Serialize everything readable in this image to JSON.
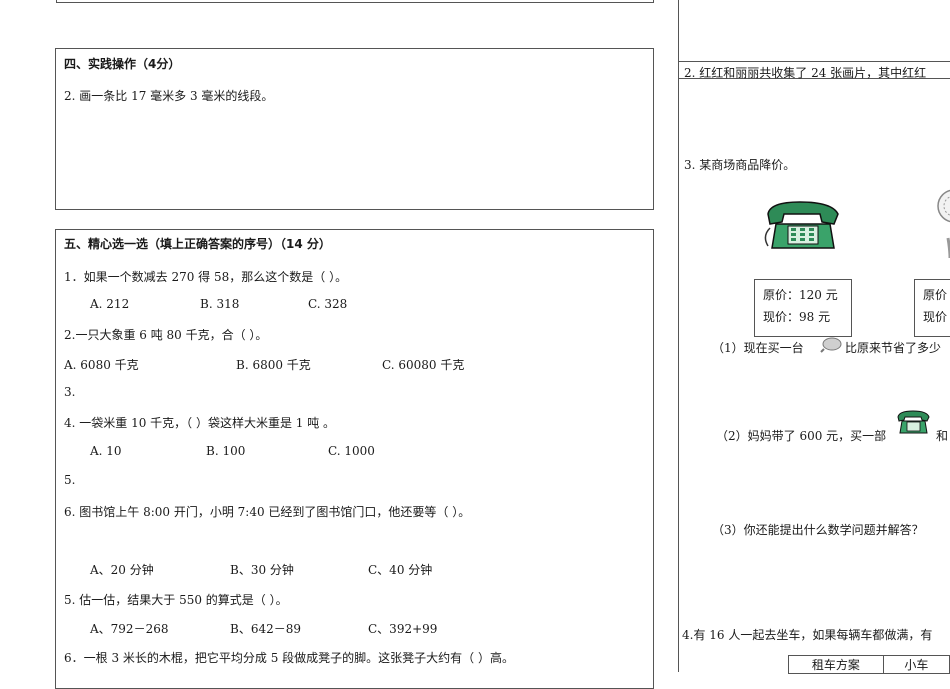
{
  "section4": {
    "title": "四、实践操作（4分）",
    "q2": "2.  画一条比 17 毫米多 3 毫米的线段。"
  },
  "section5": {
    "title": "五、精心选一选（填上正确答案的序号）（14 分）",
    "q1": "1．如果一个数减去 270 得 58，那么这个数是（      ）。",
    "q1_opts": [
      "A. 212",
      "B. 318",
      "C. 328"
    ],
    "q2": "2.一只大象重 6 吨 80 千克，合（           ）。",
    "q2_opts": [
      "A.  6080 千克",
      "B.  6800 千克",
      "C.  60080 千克"
    ],
    "q3": "3.",
    "q4": "4.  一袋米重 10 千克，（       ）袋这样大米重是 1 吨  。",
    "q4_opts": [
      "A. 10",
      "B. 100",
      "C. 1000"
    ],
    "q5": "5.",
    "q6": "6.  图书馆上午 8:00 开门，小明 7:40 已经到了图书馆门口，他还要等（           ）。",
    "q6_opts": [
      "A、20 分钟",
      "B、30 分钟",
      "C、40 分钟"
    ],
    "q7": "5.  估一估，结果大于 550 的算式是（         ）。",
    "q7_opts": [
      "A、792－268",
      "B、642－89",
      "C、392+99"
    ],
    "q8": "6．一根 3 米长的木棍，把它平均分成 5 段做成凳子的脚。这张凳子大约有（        ）高。"
  },
  "right": {
    "q2": "2.  红红和丽丽共收集了 24 张画片，其中红红",
    "q3": "3.  某商场商品降价。",
    "price1_orig": "原价：120 元",
    "price1_now": "现价：98 元",
    "price2_orig": "原价",
    "price2_now": "现价",
    "sub1_a": "（1）现在买一台",
    "sub1_b": "比原来节省了多少",
    "sub2_a": "（2）妈妈带了 600 元，买一部",
    "sub2_b": "和",
    "sub3": "（3）你还能提出什么数学问题并解答？",
    "q4": "4.有 16 人一起去坐车，如果每辆车都做满，有",
    "table_h1": "租车方案",
    "table_h2": "小车"
  },
  "colors": {
    "phone_green": "#2e8b57",
    "border": "#555555"
  }
}
